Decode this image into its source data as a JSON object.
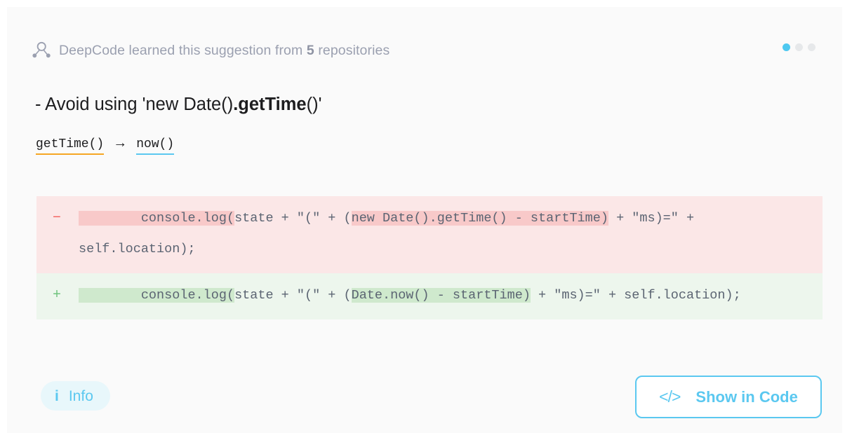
{
  "header": {
    "icon": "share-nodes-icon",
    "text_before": "DeepCode learned this suggestion from ",
    "count": "5",
    "text_after": " repositories",
    "pagination": {
      "dots": [
        "active",
        "inactive",
        "inactive"
      ],
      "active_color": "#4dc8f0",
      "inactive_color": "#e6e8ea"
    }
  },
  "suggestion": {
    "title_prefix": "- Avoid using 'new Date()",
    "title_bold": ".getTime",
    "title_suffix": "()'",
    "transform": {
      "from": "getTime()",
      "from_underline_color": "#f5a623",
      "arrow": "→",
      "to": "now()",
      "to_underline_color": "#5bc8f0"
    }
  },
  "diff": {
    "removed": {
      "marker": "−",
      "marker_color": "#f2625f",
      "background": "#fbe7e7",
      "highlight_color": "#f8c9c9",
      "segments": [
        {
          "text": "        console.log(",
          "highlight": true
        },
        {
          "text": "state + \"(\" + (",
          "highlight": false
        },
        {
          "text": "new Date().getTime() - startTime)",
          "highlight": true
        },
        {
          "text": " + \"ms)=\" + self.location);",
          "highlight": false
        }
      ]
    },
    "added": {
      "marker": "+",
      "marker_color": "#6fc37d",
      "background": "#edf6ed",
      "highlight_color": "#cfe9cd",
      "segments": [
        {
          "text": "        console.log(",
          "highlight": true
        },
        {
          "text": "state + \"(\" + (",
          "highlight": false
        },
        {
          "text": "Date.now() - startTime)",
          "highlight": true
        },
        {
          "text": " + \"ms)=\" + self.location);",
          "highlight": false
        }
      ]
    }
  },
  "footer": {
    "info_button": {
      "icon": "info-icon",
      "glyph": "i",
      "label": "Info",
      "accent": "#5bc8f0",
      "background": "#e8f7fb"
    },
    "show_in_code_button": {
      "icon": "code-brackets-icon",
      "glyph": "</>",
      "label": "Show in Code",
      "accent": "#5bc8f0"
    }
  }
}
